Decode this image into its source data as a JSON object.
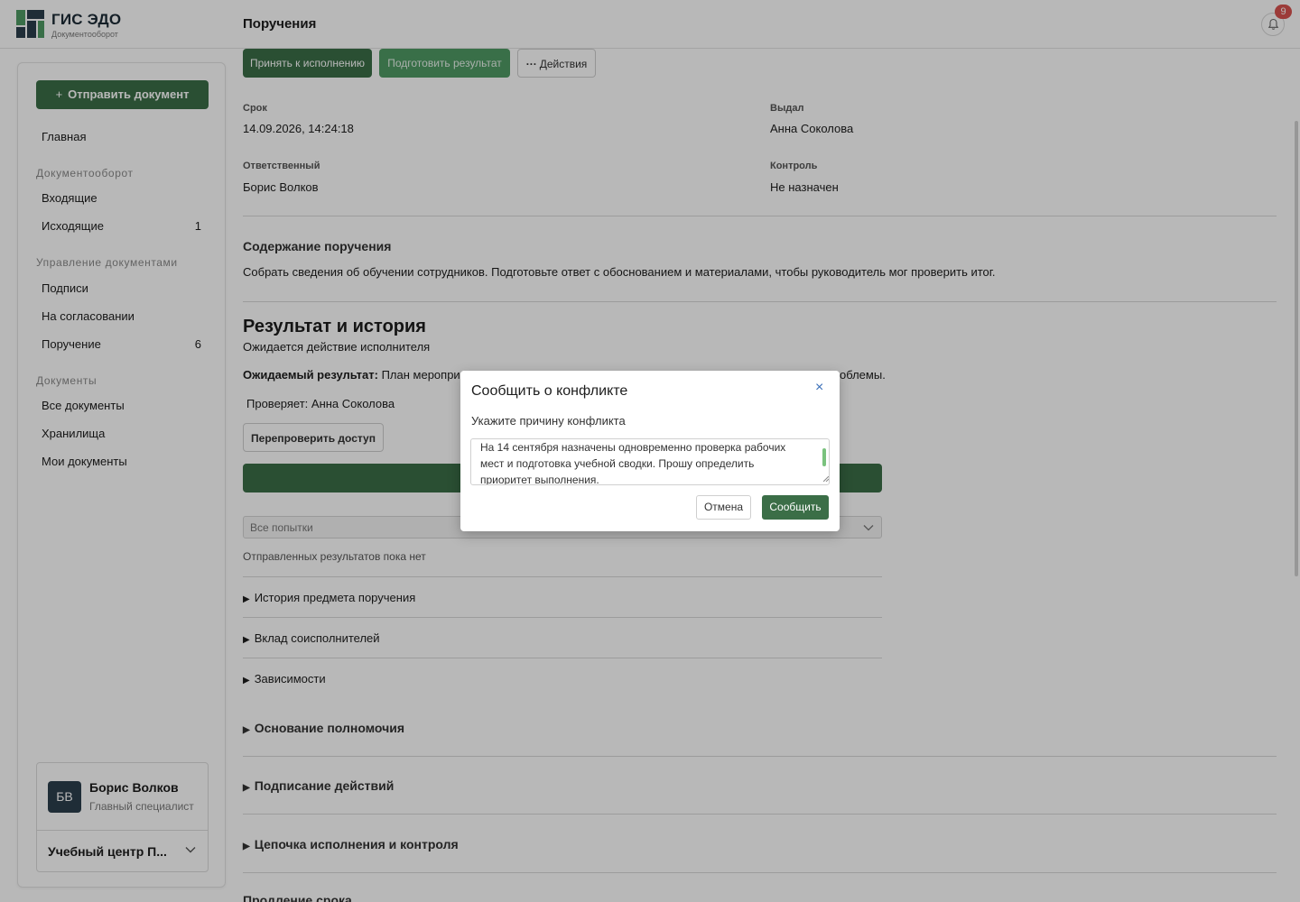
{
  "app": {
    "title": "ГИС ЭДО",
    "subtitle": "Документооборот",
    "page_title": "Поручения",
    "notification_count": "9"
  },
  "sidebar": {
    "send_button": "Отправить документ",
    "send_icon": "+",
    "home": "Главная",
    "sections": [
      {
        "title": "Документооборот",
        "items": [
          {
            "label": "Входящие",
            "count": ""
          },
          {
            "label": "Исходящие",
            "count": "1"
          }
        ]
      },
      {
        "title": "Управление документами",
        "items": [
          {
            "label": "Подписи",
            "count": ""
          },
          {
            "label": "На согласовании",
            "count": ""
          },
          {
            "label": "Поручение",
            "count": "6"
          }
        ]
      },
      {
        "title": "Документы",
        "items": [
          {
            "label": "Все документы",
            "count": ""
          },
          {
            "label": "Хранилища",
            "count": ""
          },
          {
            "label": "Мои документы",
            "count": ""
          }
        ]
      }
    ],
    "user": {
      "initials": "БВ",
      "name": "Борис Волков",
      "role": "Главный специалист",
      "org": "Учебный центр П..."
    }
  },
  "toolbar": {
    "accept": "Принять к исполнению",
    "prepare": "Подготовить результат",
    "actions": "Действия",
    "actions_icon": "···"
  },
  "details": {
    "deadline_label": "Срок",
    "deadline_value": "14.09.2026, 14:24:18",
    "issued_label": "Выдал",
    "issued_value": "Анна Соколова",
    "responsible_label": "Ответственный",
    "responsible_value": "Борис Волков",
    "control_label": "Контроль",
    "control_value": "Не назначен"
  },
  "content": {
    "heading": "Содержание поручения",
    "text": "Собрать сведения об обучении сотрудников. Подготовьте ответ с обоснованием и материалами, чтобы руководитель мог проверить итог."
  },
  "result": {
    "heading": "Результат и история",
    "status": "Ожидается действие исполнителя",
    "expected_label": "Ожидаемый результат:",
    "expected_start": "План меропри",
    "expected_end": "облемы.",
    "reviewer": "Проверяет: Анна Соколова",
    "recheck_button": "Перепроверить доступ",
    "attempts_placeholder": "Все попытки",
    "no_results": "Отправленных результатов пока нет"
  },
  "collapsibles": {
    "history": "История предмета поручения",
    "contribution": "Вклад соисполнителей",
    "dependencies": "Зависимости",
    "authority": "Основание полномочия",
    "signing": "Подписание действий",
    "chain": "Цепочка исполнения и контроля",
    "extension": "Продление срока"
  },
  "dialog": {
    "title": "Сообщить о конфликте",
    "close_icon": "×",
    "field_label": "Укажите причину конфликта",
    "field_value": "На 14 сентября назначены одновременно проверка рабочих мест и подготовка учебной сводки. Прошу определить приоритет выполнения.",
    "cancel": "Отмена",
    "submit": "Сообщить"
  },
  "colors": {
    "accent": "#3b6e47",
    "accent_light": "#4f9a64",
    "badge": "#d9534f",
    "avatar": "#2b3f4d",
    "link": "#3a6fb8"
  }
}
